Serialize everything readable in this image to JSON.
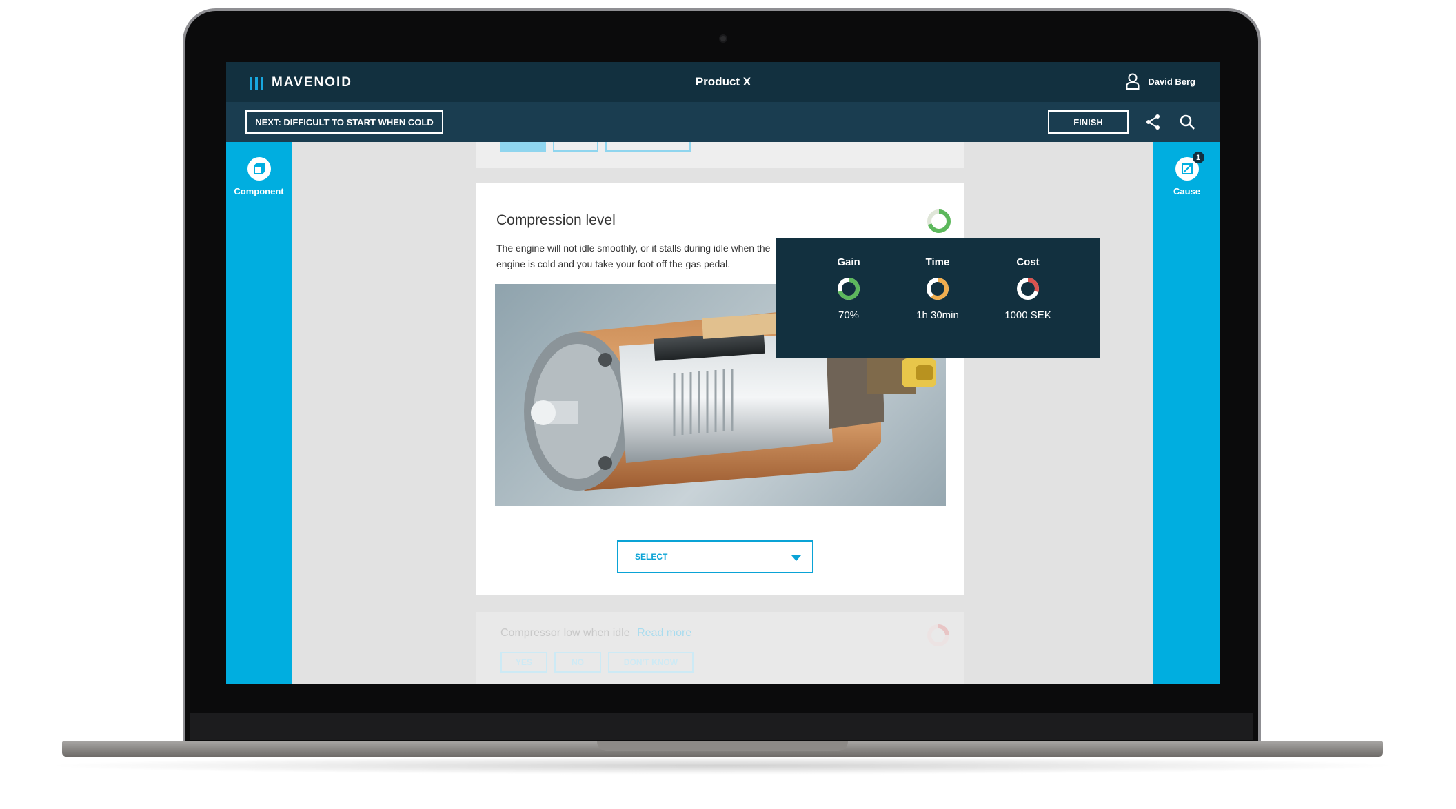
{
  "header": {
    "brand": "MAVENOID",
    "product_title": "Product X",
    "user_name": "David Berg"
  },
  "toolbar": {
    "next_label": "NEXT: DIFFICULT TO START WHEN COLD",
    "finish_label": "FINISH"
  },
  "left_rail": {
    "label": "Component",
    "icon": "cube-icon"
  },
  "right_rail": {
    "label": "Cause",
    "icon": "cause-icon",
    "badge": "1"
  },
  "card": {
    "title": "Compression level",
    "description": "The engine will not idle smoothly, or it stalls during idle when the engine is cold and you take your foot off the gas pedal.",
    "image": "fuel-pump-cutaway",
    "select_label": "SELECT",
    "progress": 0.7
  },
  "popover": {
    "metrics": [
      {
        "label": "Gain",
        "value": "70%",
        "color": "#5cb85c",
        "fraction": 0.7
      },
      {
        "label": "Time",
        "value": "1h 30min",
        "color": "#f0ad4e",
        "fraction": 0.6
      },
      {
        "label": "Cost",
        "value": "1000 SEK",
        "color": "#d9534f",
        "fraction": 0.3
      }
    ]
  },
  "next_card": {
    "title": "Compressor low when idle",
    "read_more": "Read more",
    "buttons": [
      "YES",
      "NO",
      "DON'T KNOW"
    ]
  },
  "colors": {
    "accent": "#00aee0",
    "header": "#12303f",
    "subheader": "#1a3d50"
  }
}
